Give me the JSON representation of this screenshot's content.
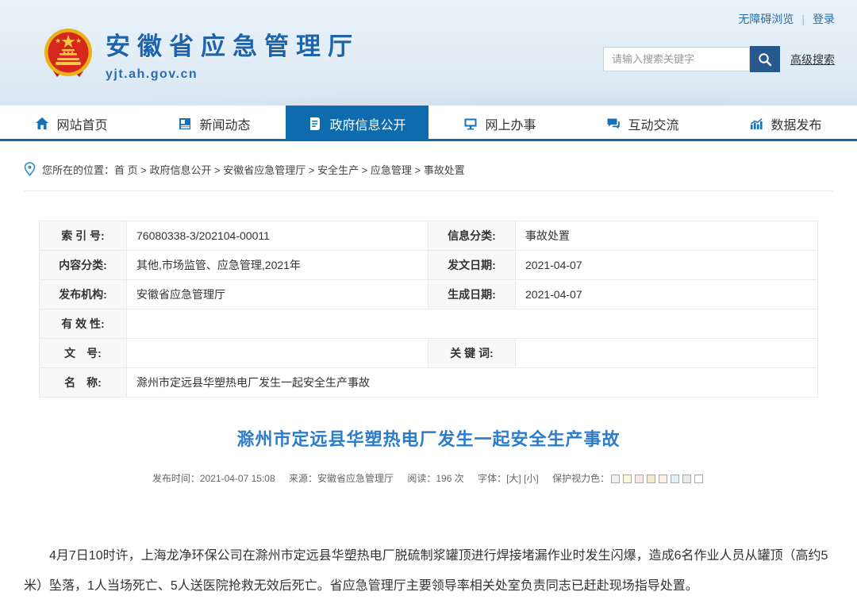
{
  "top_bar": {
    "accessibility": "无障碍浏览",
    "separator": "|",
    "login": "登录"
  },
  "header": {
    "site_name": "安徽省应急管理厅",
    "site_url": "yjt.ah.gov.cn",
    "search_placeholder": "请输入搜索关键字",
    "advanced_search": "高级搜索"
  },
  "nav": {
    "items": [
      {
        "label": "网站首页",
        "icon": "home-icon",
        "active": false
      },
      {
        "label": "新闻动态",
        "icon": "news-icon",
        "active": false
      },
      {
        "label": "政府信息公开",
        "icon": "document-icon",
        "active": true
      },
      {
        "label": "网上办事",
        "icon": "monitor-icon",
        "active": false
      },
      {
        "label": "互动交流",
        "icon": "chat-icon",
        "active": false
      },
      {
        "label": "数据发布",
        "icon": "chart-icon",
        "active": false
      }
    ]
  },
  "breadcrumb": {
    "prefix": "您所在的位置：",
    "trail": "首 页 > 政府信息公开 > 安徽省应急管理厅 > 安全生产 > 应急管理 > 事故处置"
  },
  "doc_table": {
    "index_label": "索 引 号:",
    "index_value": "76080338-3/202104-00011",
    "info_class_label": "信息分类:",
    "info_class_value": "事故处置",
    "content_class_label": "内容分类:",
    "content_class_value": "其他,市场监管、应急管理,2021年",
    "issue_date_label": "发文日期:",
    "issue_date_value": "2021-04-07",
    "publisher_label": "发布机构:",
    "publisher_value": "安徽省应急管理厅",
    "gen_date_label": "生成日期:",
    "gen_date_value": "2021-04-07",
    "validity_label": "有 效 性:",
    "validity_value": "",
    "doc_no_label": "文　号:",
    "doc_no_value": "",
    "keyword_label": "关 键 词:",
    "keyword_value": "",
    "name_label": "名　称:",
    "name_value": "滁州市定远县华塑热电厂发生一起安全生产事故"
  },
  "article": {
    "title": "滁州市定远县华塑热电厂发生一起安全生产事故",
    "meta": {
      "publish_label": "发布时间：",
      "publish_value": "2021-04-07 15:08",
      "source_label": "来源：",
      "source_value": "安徽省应急管理厅",
      "views_label": "阅读：",
      "views_value": "196 次",
      "font_label": "字体：",
      "font_large": "[大]",
      "font_small": "[小]",
      "eye_label": "保护视力色：",
      "eye_colors": [
        "#eef3f0",
        "#faf9de",
        "#fde6e0",
        "#f5e8cb",
        "#faf0dc",
        "#dcf0fa",
        "#eaeaea",
        "#ffffff"
      ]
    },
    "body": "4月7日10时许，上海龙净环保公司在滁州市定远县华塑热电厂脱硫制浆罐顶进行焊接堵漏作业时发生闪爆，造成6名作业人员从罐顶（高约5米）坠落，1人当场死亡、5人送医院抢救无效后死亡。省应急管理厅主要领导率相关处室负责同志已赶赴现场指导处置。"
  },
  "colors": {
    "nav_active_blue": "#0e6bad",
    "title_blue": "#2d7cc9",
    "link_blue": "#2a6cb0",
    "search_button_blue": "#27598f"
  }
}
